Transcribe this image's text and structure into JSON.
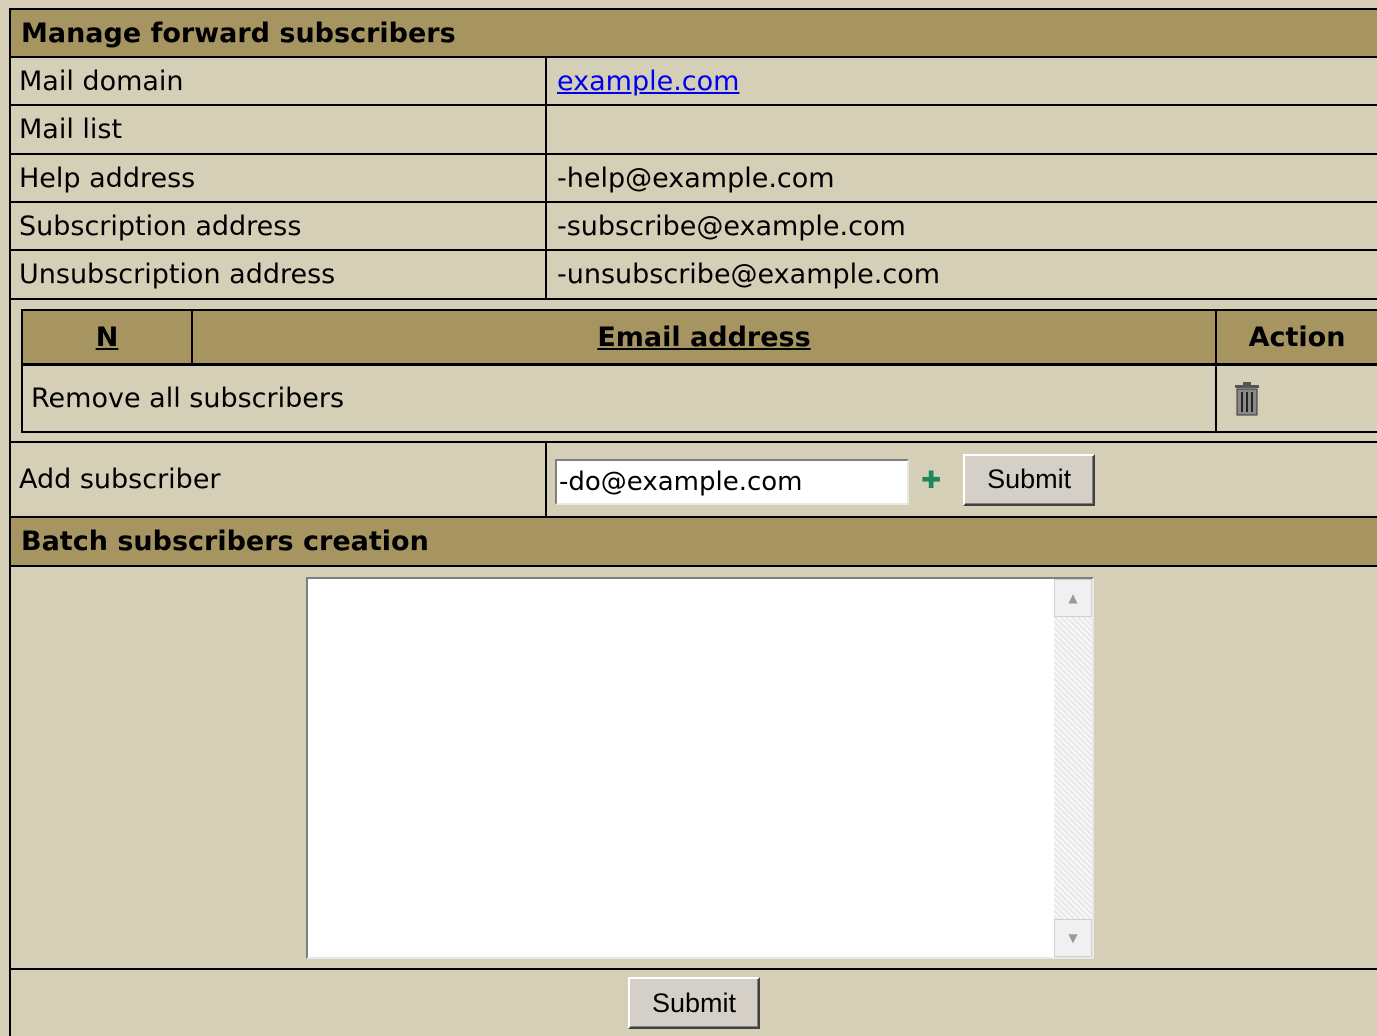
{
  "header": {
    "title": "Manage forward subscribers"
  },
  "info_rows": [
    {
      "label": "Mail domain",
      "value": "example.com",
      "is_link": true
    },
    {
      "label": "Mail list",
      "value": ""
    },
    {
      "label": "Help address",
      "value": "-help@example.com"
    },
    {
      "label": "Subscription address",
      "value": "-subscribe@example.com"
    },
    {
      "label": "Unsubscription address",
      "value": "-unsubscribe@example.com"
    }
  ],
  "subscribers_table": {
    "columns": {
      "n": "N",
      "email": "Email address",
      "action": "Action"
    },
    "remove_all_label": "Remove all subscribers",
    "remove_icon": "trash-icon"
  },
  "add_subscriber": {
    "label": "Add subscriber",
    "input_value": "-do@example.com",
    "plus_icon": "plus-icon",
    "submit_label": "Submit"
  },
  "batch": {
    "title": "Batch subscribers creation",
    "textarea_value": "",
    "submit_label": "Submit"
  },
  "colors": {
    "background": "#d5cfb8",
    "header_bg": "#a69560",
    "link": "#0000ee",
    "plus": "#1a8a5a"
  }
}
